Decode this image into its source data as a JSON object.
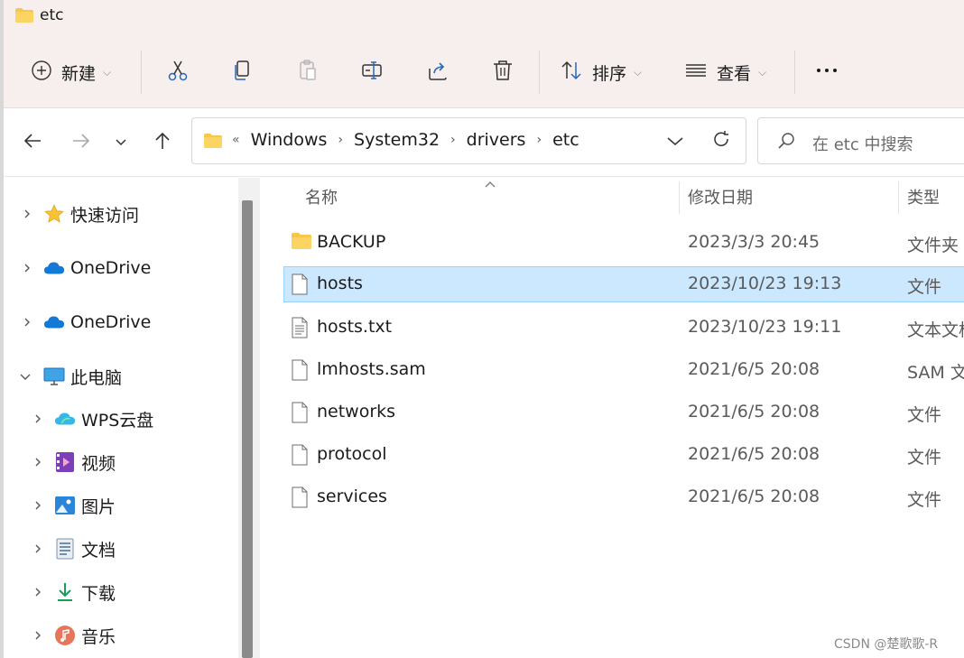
{
  "window": {
    "title": "etc"
  },
  "toolbar": {
    "new_label": "新建",
    "sort_label": "排序",
    "view_label": "查看",
    "more_label": "···"
  },
  "address": {
    "overflow": "«",
    "crumbs": [
      "Windows",
      "System32",
      "drivers",
      "etc"
    ]
  },
  "search": {
    "placeholder": "在 etc 中搜索"
  },
  "sidebar": {
    "items": [
      {
        "label": "快速访问",
        "icon": "star-icon",
        "expanded": false
      },
      {
        "label": "OneDrive",
        "icon": "cloud-icon",
        "expanded": false
      },
      {
        "label": "OneDrive",
        "icon": "cloud-icon",
        "expanded": false
      },
      {
        "label": "此电脑",
        "icon": "monitor-icon",
        "expanded": true
      },
      {
        "label": "WPS云盘",
        "icon": "wps-cloud-icon",
        "expanded": false
      },
      {
        "label": "视频",
        "icon": "video-icon",
        "expanded": false
      },
      {
        "label": "图片",
        "icon": "pictures-icon",
        "expanded": false
      },
      {
        "label": "文档",
        "icon": "documents-icon",
        "expanded": false
      },
      {
        "label": "下载",
        "icon": "download-icon",
        "expanded": false
      },
      {
        "label": "音乐",
        "icon": "music-icon",
        "expanded": false
      }
    ]
  },
  "columns": {
    "name": "名称",
    "modified": "修改日期",
    "type": "类型"
  },
  "files": [
    {
      "name": "BACKUP",
      "modified": "2023/3/3 20:45",
      "type": "文件夹",
      "icon": "folder-icon",
      "selected": false
    },
    {
      "name": "hosts",
      "modified": "2023/10/23 19:13",
      "type": "文件",
      "icon": "file-icon",
      "selected": true
    },
    {
      "name": "hosts.txt",
      "modified": "2023/10/23 19:11",
      "type": "文本文档",
      "icon": "text-file-icon",
      "selected": false
    },
    {
      "name": "lmhosts.sam",
      "modified": "2021/6/5 20:08",
      "type": "SAM 文件",
      "icon": "file-icon",
      "selected": false
    },
    {
      "name": "networks",
      "modified": "2021/6/5 20:08",
      "type": "文件",
      "icon": "file-icon",
      "selected": false
    },
    {
      "name": "protocol",
      "modified": "2021/6/5 20:08",
      "type": "文件",
      "icon": "file-icon",
      "selected": false
    },
    {
      "name": "services",
      "modified": "2021/6/5 20:08",
      "type": "文件",
      "icon": "file-icon",
      "selected": false
    }
  ],
  "watermark": "CSDN @楚歌歌-R",
  "colors": {
    "folder": "#f8c64a",
    "selection": "#cce8ff",
    "accent": "#0067c0"
  }
}
